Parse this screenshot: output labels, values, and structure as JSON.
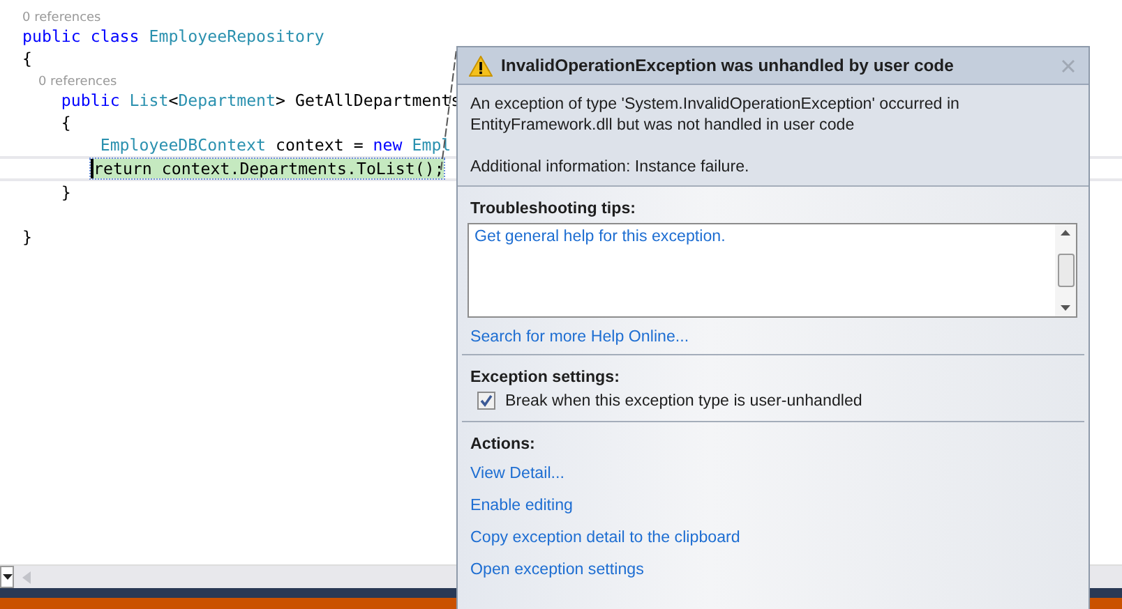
{
  "editor": {
    "lines": [
      {
        "kind": "codelens",
        "text": "0 references"
      },
      {
        "kind": "code",
        "highlighted": false,
        "tokens": [
          {
            "kind": "keyword",
            "text": "public class"
          },
          {
            "kind": "type",
            "text": " EmployeeRepository"
          }
        ]
      },
      {
        "kind": "code",
        "highlighted": false,
        "tokens": [
          {
            "kind": "plain",
            "text": "{"
          }
        ]
      },
      {
        "kind": "codelens",
        "text": "    0 references"
      },
      {
        "kind": "code",
        "highlighted": false,
        "tokens": [
          {
            "kind": "keyword",
            "text": "    public"
          },
          {
            "kind": "type",
            "text": " List"
          },
          {
            "kind": "plain",
            "text": "<"
          },
          {
            "kind": "type",
            "text": "Department"
          },
          {
            "kind": "plain",
            "text": "> GetAllDepartments"
          }
        ]
      },
      {
        "kind": "code",
        "highlighted": false,
        "tokens": [
          {
            "kind": "plain",
            "text": "    {"
          }
        ]
      },
      {
        "kind": "code",
        "highlighted": false,
        "tokens": [
          {
            "kind": "type",
            "text": "        EmployeeDBContext"
          },
          {
            "kind": "plain",
            "text": " context = "
          },
          {
            "kind": "keyword",
            "text": "new"
          },
          {
            "kind": "type",
            "text": " Empl"
          }
        ]
      },
      {
        "kind": "code",
        "highlighted": true,
        "tokens": [
          {
            "kind": "plain",
            "text": "return context.Departments.ToList();"
          }
        ]
      },
      {
        "kind": "code",
        "highlighted": false,
        "tokens": [
          {
            "kind": "plain",
            "text": "    }"
          }
        ]
      },
      {
        "kind": "blank"
      },
      {
        "kind": "code",
        "highlighted": false,
        "tokens": [
          {
            "kind": "plain",
            "text": "}"
          }
        ]
      }
    ]
  },
  "exception_helper": {
    "title": "InvalidOperationException was unhandled by user code",
    "message": "An exception of type 'System.InvalidOperationException' occurred in EntityFramework.dll but was not handled in user code",
    "additional_info": "Additional information: Instance failure.",
    "troubleshooting": {
      "heading": "Troubleshooting tips:",
      "tips": [
        "Get general help for this exception."
      ],
      "search_link": "Search for more Help Online..."
    },
    "settings": {
      "heading": "Exception settings:",
      "options": [
        {
          "label": "Break when this exception type is user-unhandled",
          "checked": true
        }
      ]
    },
    "actions": {
      "heading": "Actions:",
      "links": [
        "View Detail...",
        "Enable editing",
        "Copy exception detail to the clipboard",
        "Open exception settings"
      ]
    }
  }
}
